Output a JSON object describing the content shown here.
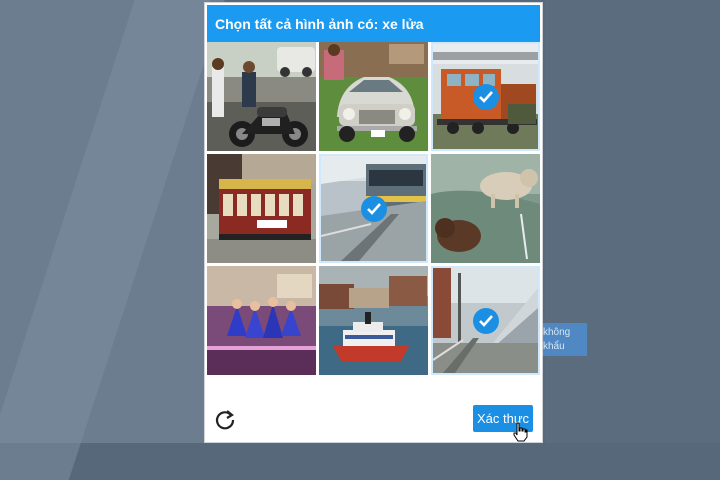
{
  "captcha": {
    "instruction": "Chọn tất cả hình ảnh có: xe lửa",
    "verify_label": "Xác thực",
    "tiles": [
      {
        "subject": "motorcycle",
        "selected": false
      },
      {
        "subject": "vintage-car",
        "selected": false
      },
      {
        "subject": "train",
        "selected": true
      },
      {
        "subject": "cable-car",
        "selected": false
      },
      {
        "subject": "train-platform",
        "selected": true
      },
      {
        "subject": "dogs",
        "selected": false
      },
      {
        "subject": "dancers",
        "selected": false
      },
      {
        "subject": "boat",
        "selected": false
      },
      {
        "subject": "train-station",
        "selected": true
      }
    ]
  },
  "background": {
    "tab_line1": "không",
    "tab_line2": "khẩu"
  },
  "colors": {
    "header": "#1a9af0",
    "check": "#1a8fe3",
    "button": "#1a8fe3"
  }
}
